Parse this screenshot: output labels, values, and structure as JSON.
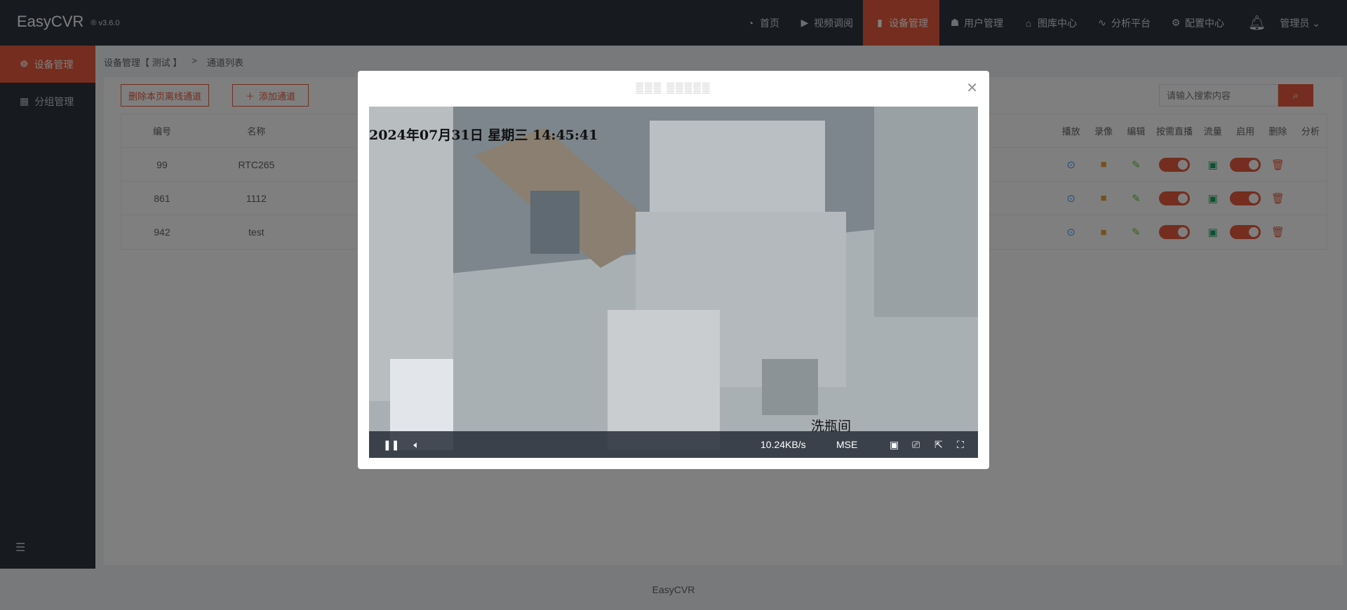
{
  "app": {
    "name": "EasyCVR",
    "version": "v3.6.0"
  },
  "nav": {
    "items": [
      {
        "label": "首页",
        "icon": "dashboard-icon"
      },
      {
        "label": "视频调阅",
        "icon": "play-icon"
      },
      {
        "label": "设备管理",
        "icon": "device-icon",
        "active": true
      },
      {
        "label": "用户管理",
        "icon": "user-icon"
      },
      {
        "label": "图库中心",
        "icon": "gallery-icon"
      },
      {
        "label": "分析平台",
        "icon": "pulse-icon"
      },
      {
        "label": "配置中心",
        "icon": "gear-icon"
      }
    ],
    "user": "管理员"
  },
  "sidebar": {
    "items": [
      {
        "label": "设备管理",
        "icon": "device-icon",
        "active": true
      },
      {
        "label": "分组管理",
        "icon": "grid-icon"
      }
    ]
  },
  "breadcrumb": [
    "设备管理【 测试 】",
    ">",
    "通道列表"
  ],
  "toolbar": {
    "delete_offline_label": "删除本页离线通道",
    "add_channel_label": "添加通道",
    "search_placeholder": "请输入搜索内容"
  },
  "table": {
    "headers": {
      "id": "编号",
      "name": "名称",
      "play": "播放",
      "record": "录像",
      "edit": "编辑",
      "ondemand": "按需直播",
      "flow": "流量",
      "enable": "启用",
      "delete": "删除",
      "analysis": "分析"
    },
    "rows": [
      {
        "id": "99",
        "name": "RTC265"
      },
      {
        "id": "861",
        "name": "1112"
      },
      {
        "id": "942",
        "name": "test"
      }
    ]
  },
  "modal": {
    "title": "▒▒▒ ▒▒▒▒▒",
    "osd_time": "2024年07月31日 星期三 14:45:41",
    "location": "洗瓶间",
    "speed": "10.24KB/s",
    "mode": "MSE"
  },
  "footer": "EasyCVR",
  "colors": {
    "accent": "#e85a3c",
    "topbar": "#2f353e"
  }
}
